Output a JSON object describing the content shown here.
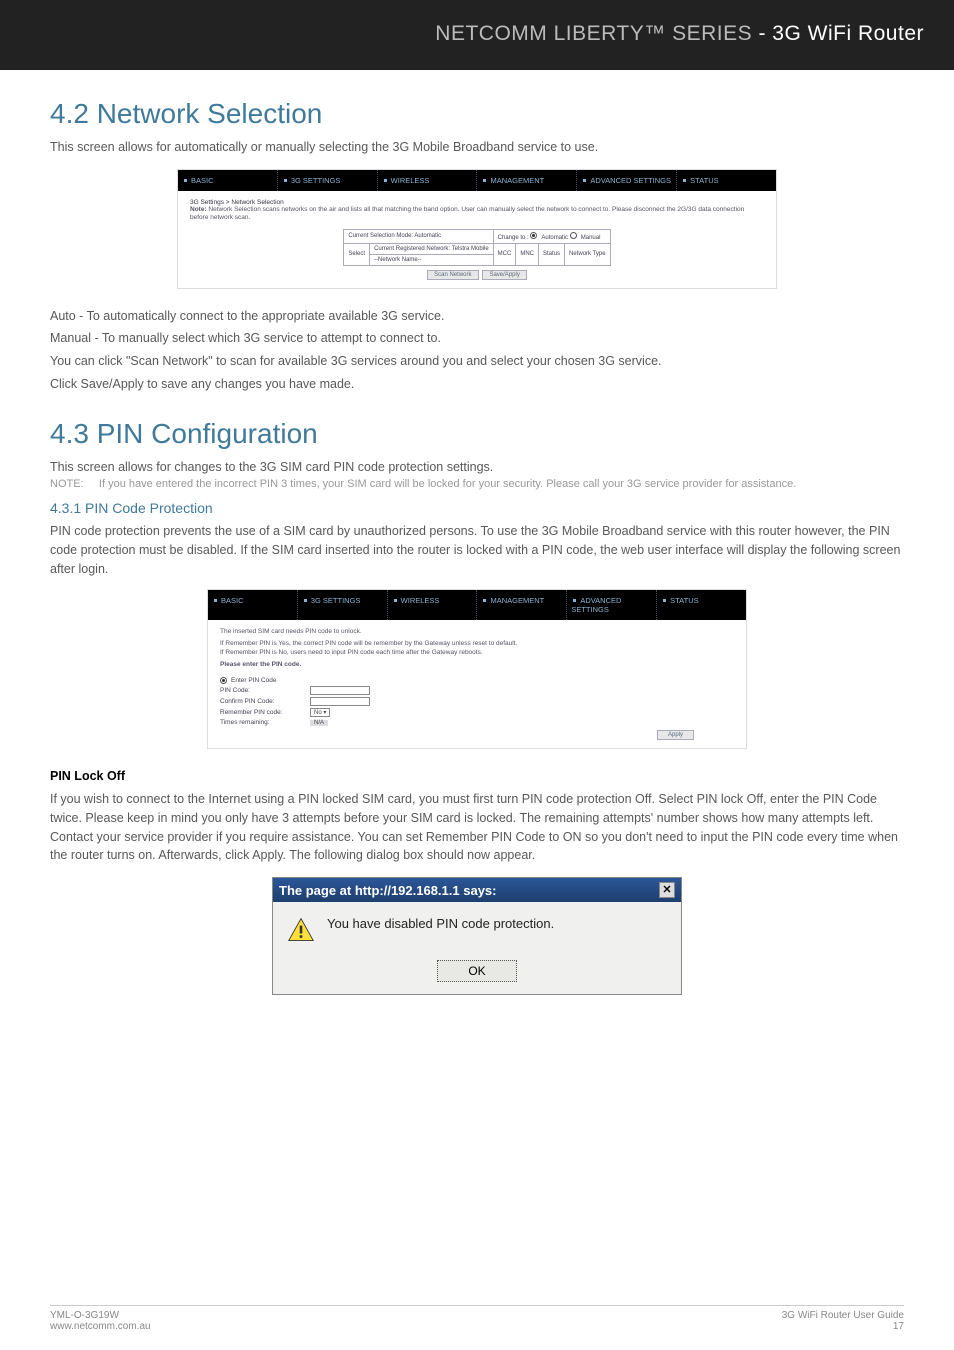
{
  "header": {
    "prefix": "NETCOMM LIBERTY™ SERIES",
    "suffix": "- 3G WiFi Router"
  },
  "sec42": {
    "heading": "4.2 Network Selection",
    "desc": "This screen allows for automatically or manually selecting the 3G Mobile Broadband service to use.",
    "tabs": [
      "BASIC",
      "3G SETTINGS",
      "WIRELESS",
      "MANAGEMENT",
      "ADVANCED SETTINGS",
      "STATUS"
    ],
    "crumb": "3G Settings > Network Selection",
    "noteLabel": "Note:",
    "note": "Network Selection scans networks on the air and lists all that matching the band option. User can manually select the network to connect to. Please disconnect the 2G/3G data connection before network scan.",
    "row1_label": "Current Selection Mode: Automatic",
    "row1_change": "Change to :",
    "row1_auto": "Automatic",
    "row1_manual": "Manual",
    "row2_select": "Select",
    "row2_reg": "Current Registered Network: Telstra Mobile",
    "row2_hdr": [
      "MCC",
      "MNC",
      "Status",
      "Network Type"
    ],
    "row2_nn": "--Network Name--",
    "btn_scan": "Scan Network",
    "btn_save": "Save/Apply",
    "p1": "Auto - To automatically connect to the appropriate available 3G service.",
    "p2": "Manual - To manually select which 3G service to attempt to connect to.",
    "p3": "You can click \"Scan Network\" to scan for available 3G services around you and select your chosen 3G service.",
    "p4": "Click Save/Apply to save any changes you have made."
  },
  "sec43": {
    "heading": "4.3 PIN Configuration",
    "desc": "This screen allows for changes to the 3G SIM card PIN code protection settings.",
    "noteLabel": "NOTE:",
    "note": "If you have entered the incorrect PIN 3 times, your SIM card will be locked for your security. Please call your 3G service provider for assistance.",
    "sub": "4.3.1    PIN Code Protection",
    "p1": "PIN code protection prevents the use of a SIM card by unauthorized persons. To use the 3G Mobile Broadband service with this router however, the PIN code protection must be disabled. If the SIM card inserted into the router is locked with a PIN code, the web user interface will display the following screen after login.",
    "tabs": [
      "BASIC",
      "3G SETTINGS",
      "WIRELESS",
      "MANAGEMENT",
      "ADVANCED SETTINGS",
      "STATUS"
    ],
    "l1": "The inserted SIM card needs PIN code to unlock.",
    "l2": "If Remember PIN is Yes, the correct PIN code will be remember by the Gateway unless reset to default.",
    "l3": "If Remember PIN is No, users need to input PIN code each time after the Gateway reboots.",
    "l4": "Please enter the PIN code.",
    "f_enter": "Enter PIN Code",
    "f_pin": "PIN Code:",
    "f_confirm": "Confirm PIN Code:",
    "f_remember": "Remember PIN code:",
    "f_remember_v": "No",
    "f_times": "Times remaining:",
    "f_times_v": "N/A",
    "btn_apply": "Apply",
    "pinlock_h": "PIN Lock Off",
    "pinlock_p": "If you wish to connect to the Internet using a PIN locked SIM card, you must first turn PIN code protection Off. Select PIN lock Off, enter the PIN Code twice. Please keep in mind you only have 3 attempts before your SIM card is locked. The remaining attempts' number shows how many attempts left. Contact your service provider if you require assistance. You can set Remember PIN Code to ON so you don't need to input the PIN code every time when the router turns on. Afterwards, click Apply. The following dialog box should now appear."
  },
  "dialog": {
    "title": "The page at http://192.168.1.1 says:",
    "msg": "You have disabled PIN code protection.",
    "ok": "OK"
  },
  "footer": {
    "l1": "YML-O-3G19W",
    "l2": "www.netcomm.com.au",
    "r1": "3G WiFi Router User Guide",
    "r2": "17"
  }
}
